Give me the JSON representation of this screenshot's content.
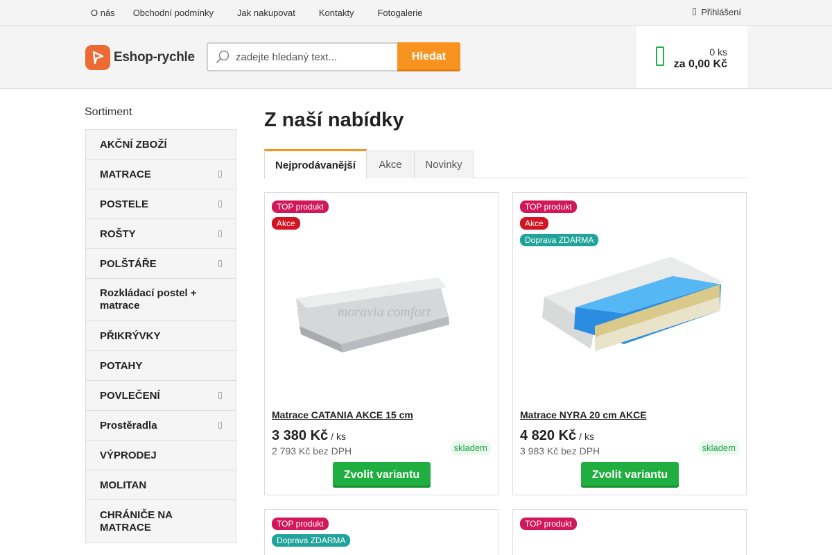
{
  "topnav": {
    "links": [
      "O nás",
      "Obchodní podmínky",
      "Jak nakupovat",
      "Kontakty",
      "Fotogalerie"
    ],
    "login_label": "Přihlášení"
  },
  "header": {
    "logo_text": "Eshop-rychle",
    "search_placeholder": "zadejte hledaný text...",
    "search_button": "Hledat",
    "cart_qty": "0 ks",
    "cart_total": "za 0,00 Kč"
  },
  "sidebar": {
    "title": "Sortiment",
    "items": [
      {
        "label": "AKČNÍ ZBOŽÍ",
        "submenu": false
      },
      {
        "label": "MATRACE",
        "submenu": true
      },
      {
        "label": "POSTELE",
        "submenu": true
      },
      {
        "label": "ROŠTY",
        "submenu": true
      },
      {
        "label": "POLŠTÁŘE",
        "submenu": true
      },
      {
        "label": "Rozkládací postel + matrace",
        "submenu": false
      },
      {
        "label": "PŘIKRÝVKY",
        "submenu": false
      },
      {
        "label": "POTAHY",
        "submenu": false
      },
      {
        "label": "POVLEČENÍ",
        "submenu": true
      },
      {
        "label": "Prostěradla",
        "submenu": true
      },
      {
        "label": "VÝPRODEJ",
        "submenu": false
      },
      {
        "label": "MOLITAN",
        "submenu": false
      },
      {
        "label": "CHRÁNIČE NA MATRACE",
        "submenu": false
      }
    ]
  },
  "main": {
    "title": "Z naší nabídky",
    "tabs": [
      "Nejprodávanější",
      "Akce",
      "Novinky"
    ],
    "active_tab": 0
  },
  "products": [
    {
      "badges": [
        "TOP produkt",
        "Akce"
      ],
      "name": "Matrace CATANIA AKCE 15 cm",
      "price": "3 380 Kč",
      "unit": "/ ks",
      "price_no_vat": "2 793 Kč bez DPH",
      "stock": "skladem",
      "button": "Zvolit variantu",
      "image_watermark": "moravia comfort"
    },
    {
      "badges": [
        "TOP produkt",
        "Akce",
        "Doprava ZDARMA"
      ],
      "name": "Matrace NYRA 20 cm AKCE",
      "price": "4 820 Kč",
      "unit": "/ ks",
      "price_no_vat": "3 983 Kč bez DPH",
      "stock": "skladem",
      "button": "Zvolit variantu"
    },
    {
      "badges": [
        "TOP produkt",
        "Doprava ZDARMA"
      ]
    },
    {
      "badges": [
        "TOP produkt"
      ]
    }
  ],
  "colors": {
    "accent_orange": "#f7931e",
    "cart_green": "#21b04b",
    "button_green": "#1fae3f",
    "badge_top": "#d0185a",
    "badge_akce": "#d31522",
    "badge_free": "#20a39b",
    "logo_orange": "#ec6a34"
  }
}
